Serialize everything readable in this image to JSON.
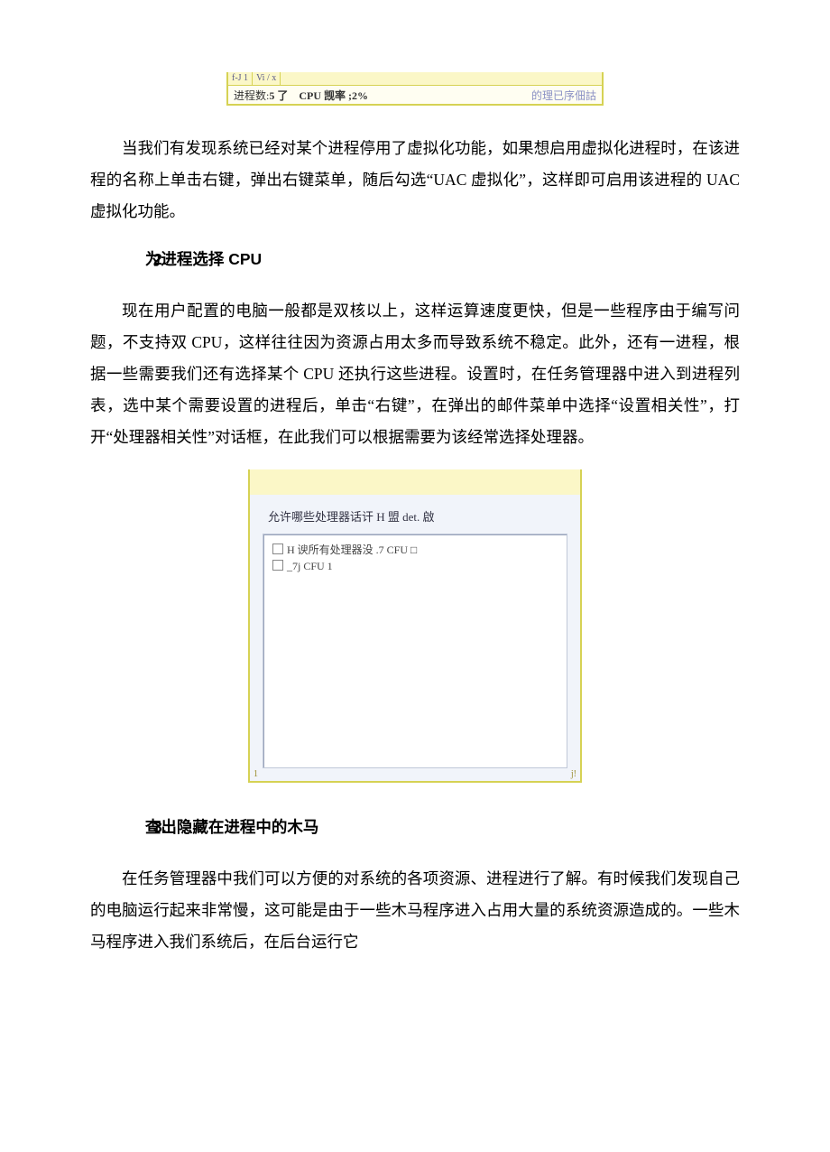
{
  "fig1": {
    "top_left": "f-J 1",
    "top_mid": "Vi / x",
    "process_label": "进程数:",
    "process_value": "5 了",
    "cpu_label": "CPU 觊率 ;",
    "cpu_value": "2%",
    "right_text": "的理已序佃詁"
  },
  "para1": "当我们有发现系统已经对某个进程停用了虚拟化功能，如果想启用虚拟化进程时，在该进程的名称上单击右键，弹出右键菜单，随后勾选“UAC 虚拟化”，这样即可启用该进程的 UAC 虚拟化功能。",
  "heading2_num": "2.",
  "heading2_text": "为进程选择 CPU",
  "para2": "现在用户配置的电脑一般都是双核以上，这样运算速度更快，但是一些程序由于编写问题，不支持双 CPU，这样往往因为资源占用太多而导致系统不稳定。此外，还有一进程，根据一些需要我们还有选择某个 CPU 还执行这些进程。设置时，在任务管理器中进入到进程列表，选中某个需要设置的进程后，单击“右键”，在弹出的邮件菜单中选择“设置相关性”，打开“处理器相关性”对话框，在此我们可以根据需要为该经常选择处理器。",
  "fig2": {
    "prompt": "允许哪些处理器话讦 H 盟 det. 啟",
    "row1": "H 谀所有处理器没  .7 CFU □",
    "row2": "_7j CFU 1",
    "bl": "1",
    "tick": "j!"
  },
  "heading3_num": "3.",
  "heading3_text": "查出隐藏在进程中的木马",
  "para3": "在任务管理器中我们可以方便的对系统的各项资源、进程进行了解。有时候我们发现自己的电脑运行起来非常慢，这可能是由于一些木马程序进入占用大量的系统资源造成的。一些木马程序进入我们系统后，在后台运行它"
}
